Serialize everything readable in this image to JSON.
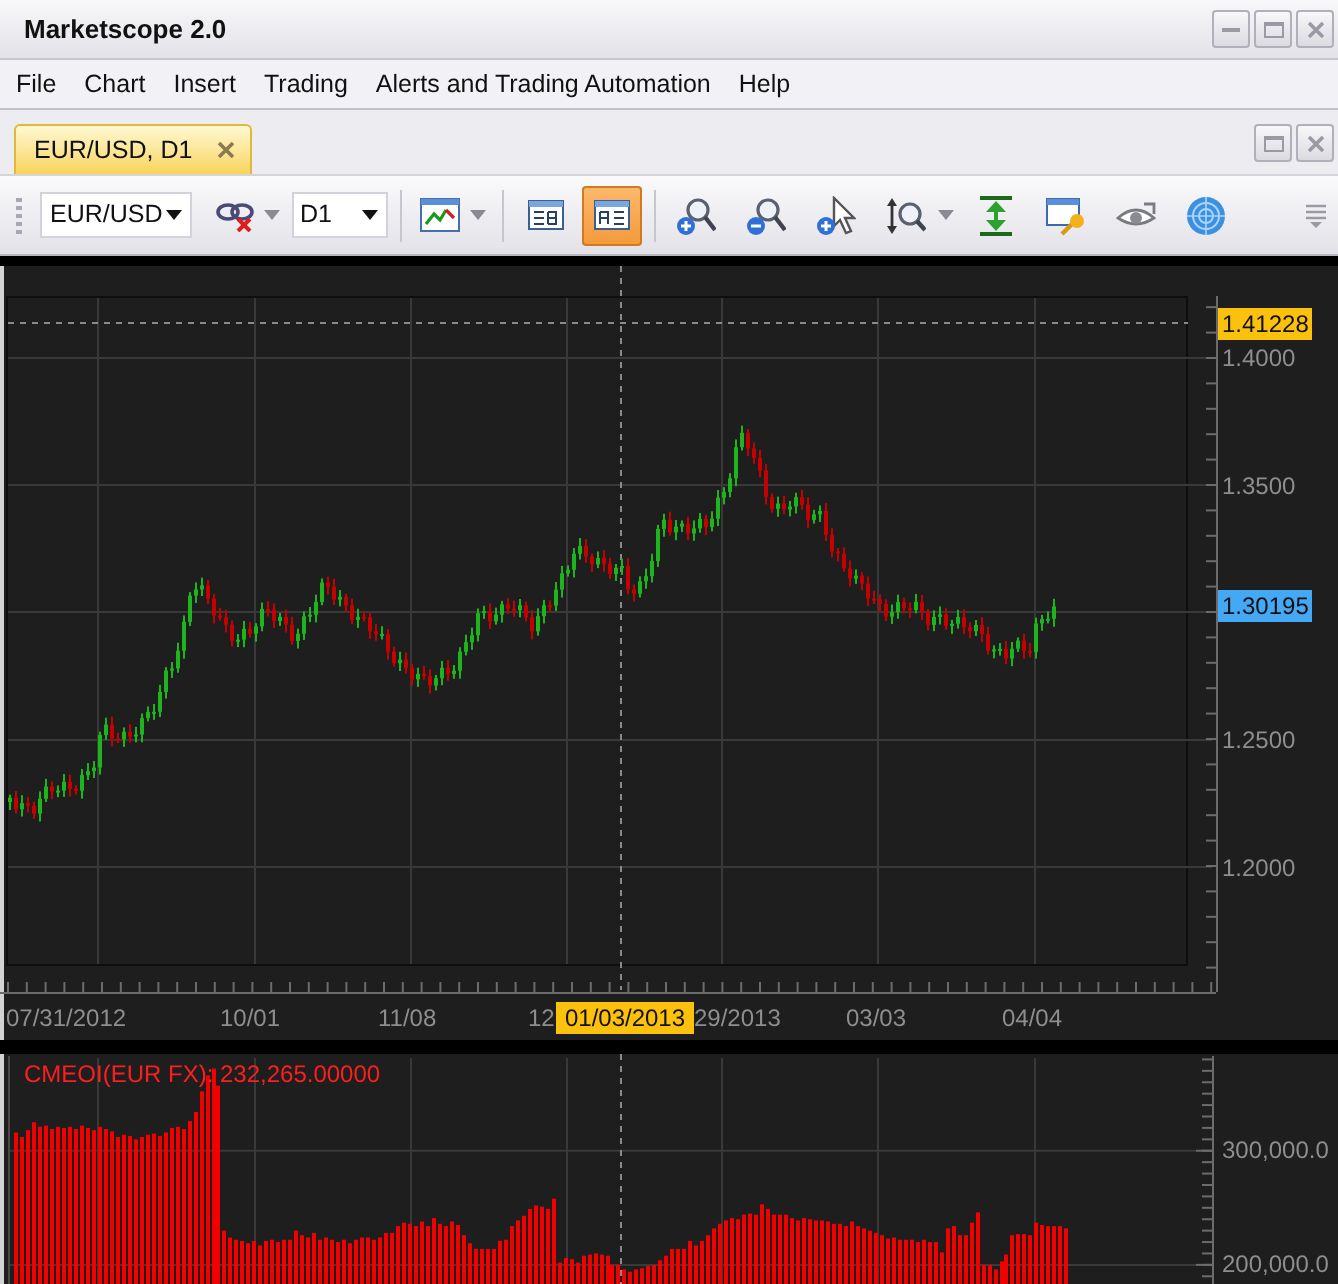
{
  "window": {
    "title": "Marketscope 2.0"
  },
  "menu": [
    "File",
    "Chart",
    "Insert",
    "Trading",
    "Alerts and Trading Automation",
    "Help"
  ],
  "tabs": [
    {
      "label": "EUR/USD, D1",
      "selected": true
    }
  ],
  "toolbar": {
    "symbol": "EUR/USD",
    "period": "D1",
    "view_buttons": [
      {
        "selected": false
      },
      {
        "selected": true
      }
    ]
  },
  "price_chart": {
    "high_marker": "1.41228",
    "price_labels": [
      "1.4000",
      "1.3500",
      "1.2500",
      "1.2000"
    ],
    "last_price_marker": "1.30195",
    "date_labels": [
      "07/31/2012",
      "10/01",
      "11/08",
      "12",
      "29/2013",
      "03/03",
      "04/04"
    ],
    "cursor_date": "01/03/2013"
  },
  "indicator_panel": {
    "chart_data": {
      "type": "bar",
      "title": "CMEOI(EUR FX): 232,265.00000",
      "ylim": [
        185000,
        383000
      ],
      "yticks": [
        {
          "value": 300000,
          "label": "300,000.0"
        },
        {
          "value": 200000,
          "label": "200,000.0"
        }
      ],
      "values": [
        316000,
        312000,
        318000,
        325000,
        321000,
        322000,
        319000,
        321000,
        320000,
        321000,
        319000,
        322000,
        320000,
        318000,
        321000,
        319000,
        317000,
        312000,
        314000,
        313000,
        310000,
        312000,
        314000,
        315000,
        313000,
        316000,
        320000,
        321000,
        319000,
        326000,
        334000,
        352000,
        366000,
        372000,
        357000,
        230000,
        224000,
        222000,
        221000,
        219000,
        221000,
        217000,
        221000,
        222000,
        220000,
        222000,
        222000,
        230000,
        226000,
        224000,
        228000,
        222000,
        224000,
        222000,
        220000,
        222000,
        219000,
        222000,
        224000,
        224000,
        222000,
        224000,
        228000,
        228000,
        234000,
        237000,
        236000,
        234000,
        238000,
        234000,
        241000,
        236000,
        234000,
        238000,
        235000,
        226000,
        219000,
        214000,
        214000,
        214000,
        214000,
        221000,
        222000,
        234000,
        239000,
        243000,
        249000,
        252000,
        251000,
        249000,
        258000,
        202000,
        206000,
        205000,
        202000,
        208000,
        209000,
        210000,
        209000,
        208000,
        200000,
        200000,
        196000,
        194000,
        196000,
        197000,
        199000,
        200000,
        204000,
        208000,
        214000,
        214000,
        214000,
        221000,
        217000,
        221000,
        226000,
        232000,
        236000,
        239000,
        241000,
        240000,
        244000,
        245000,
        244000,
        253000,
        249000,
        244000,
        244000,
        244000,
        241000,
        239000,
        241000,
        240000,
        239000,
        239000,
        238000,
        236000,
        236000,
        234000,
        238000,
        234000,
        232000,
        230000,
        228000,
        226000,
        223000,
        224000,
        222000,
        222000,
        222000,
        220000,
        222000,
        220000,
        220000,
        211000,
        232000,
        234000,
        226000,
        226000,
        237000,
        246000,
        200000,
        200000,
        196000,
        203000,
        209000,
        226000,
        227000,
        227000,
        226000,
        237000,
        235000,
        234000,
        234000,
        234000,
        232000,
        null,
        null,
        null,
        null,
        null,
        null,
        null,
        null,
        null,
        null,
        null,
        null,
        null,
        null,
        null,
        null,
        null,
        null,
        null,
        null,
        null
      ]
    }
  }
}
